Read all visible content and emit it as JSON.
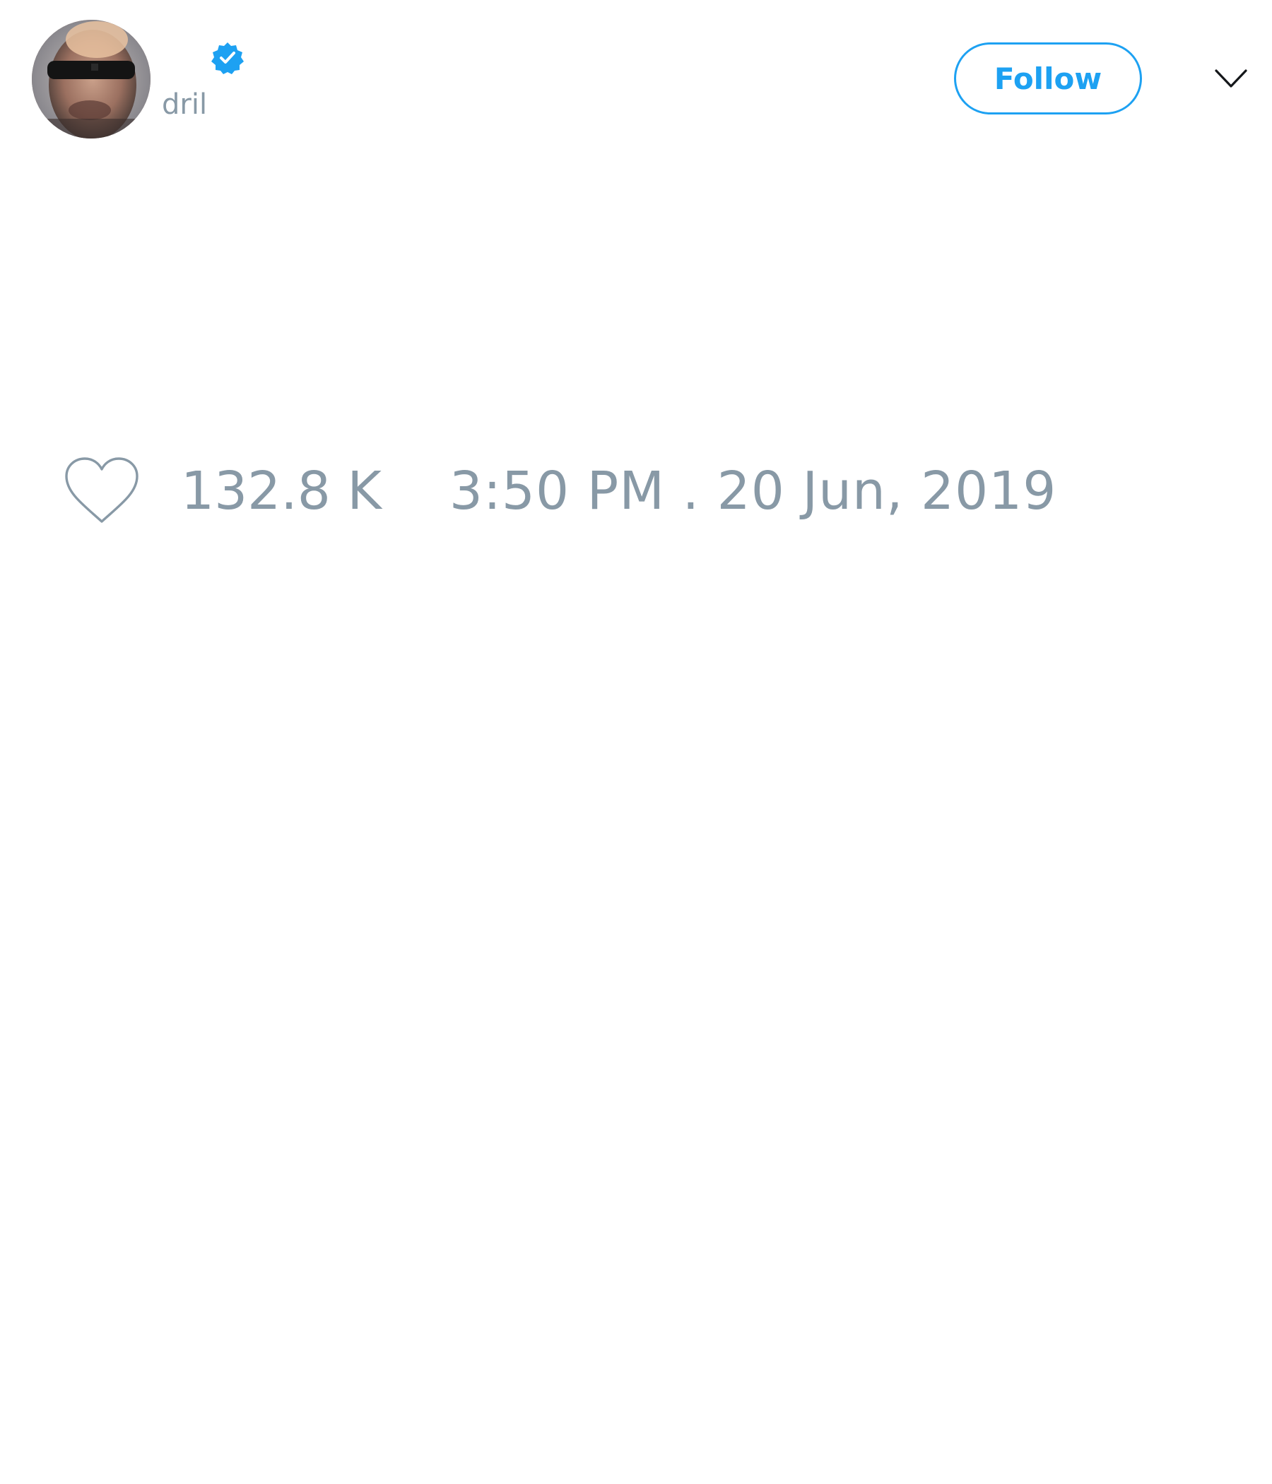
{
  "tweet": {
    "author": {
      "handle": "dril",
      "verified": true,
      "avatar_icon": "profile-photo"
    },
    "follow_button_label": "Follow",
    "menu_icon": "chevron-down-icon",
    "likes": {
      "icon": "heart-icon",
      "count": "132.8 K"
    },
    "timestamp": "3:50 PM . 20 Jun, 2019"
  },
  "colors": {
    "accent": "#1da1f2",
    "muted_text": "#8899a6",
    "background": "#ffffff"
  }
}
